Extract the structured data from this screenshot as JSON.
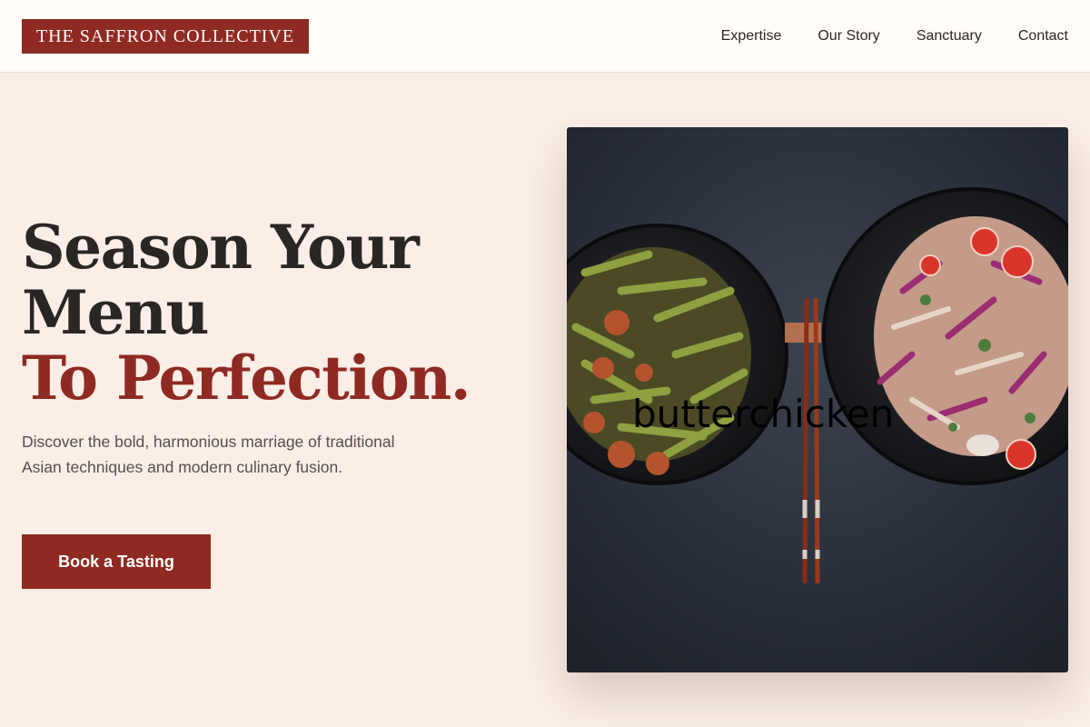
{
  "brand": {
    "name": "THE SAFFRON COLLECTIVE"
  },
  "nav": {
    "items": [
      "Expertise",
      "Our Story",
      "Sanctuary",
      "Contact"
    ]
  },
  "hero": {
    "headline": {
      "line1": "Season Your",
      "line2": "Menu",
      "line3": "To Perfection."
    },
    "description": "Discover the bold, harmonious marriage of traditional Asian techniques and modern culinary fusion.",
    "cta_label": "Book a Tasting",
    "image_watermark": "butterchicken"
  },
  "colors": {
    "accent": "#8f2a22",
    "background": "#fbeee7",
    "text": "#2a2623"
  }
}
